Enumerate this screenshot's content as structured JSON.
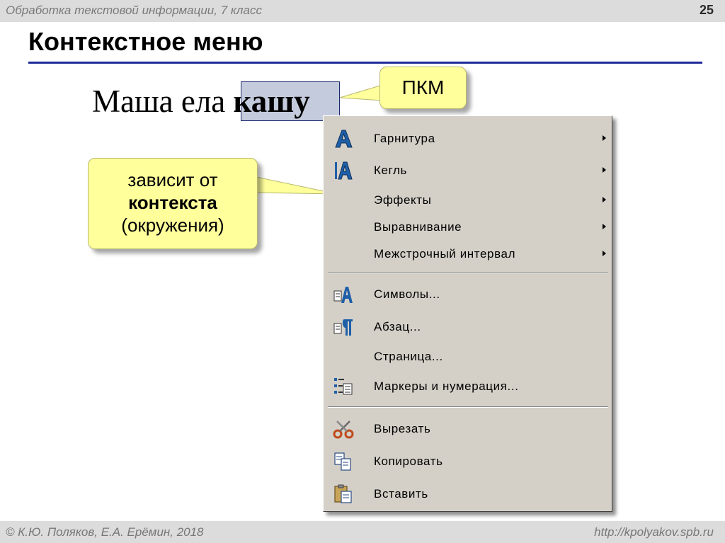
{
  "header": {
    "course_title": "Обработка текстовой информации, 7 класс",
    "slide_number": "25"
  },
  "slide": {
    "title": "Контекстное меню",
    "sentence_plain": "Маша ела ",
    "sentence_selected": "кашу",
    "sentence_end": "."
  },
  "callouts": {
    "pkm": "ПКМ",
    "context_line1": "зависит от",
    "context_line2": "контекста",
    "context_line3": "(окружения)"
  },
  "menu": {
    "items": [
      {
        "label": "Гарнитура",
        "icon": "font-a-icon",
        "submenu": true
      },
      {
        "label": "Кегль",
        "icon": "font-size-icon",
        "submenu": true
      },
      {
        "label": "Эффекты",
        "icon": null,
        "submenu": true
      },
      {
        "label": "Выравнивание",
        "icon": null,
        "submenu": true
      },
      {
        "label": "Межстрочный интервал",
        "icon": null,
        "submenu": true
      },
      {
        "label": "Символы...",
        "icon": "character-format-icon",
        "submenu": false
      },
      {
        "label": "Абзац...",
        "icon": "paragraph-format-icon",
        "submenu": false
      },
      {
        "label": "Страница...",
        "icon": null,
        "submenu": false
      },
      {
        "label": "Маркеры и нумерация...",
        "icon": "bullets-numbering-icon",
        "submenu": false
      },
      {
        "label": "Вырезать",
        "icon": "scissors-icon",
        "submenu": false
      },
      {
        "label": "Копировать",
        "icon": "copy-icon",
        "submenu": false
      },
      {
        "label": "Вставить",
        "icon": "paste-icon",
        "submenu": false
      }
    ]
  },
  "footer": {
    "authors": "© К.Ю. Поляков, Е.А. Ерёмин, 2018",
    "url": "http://kpolyakov.spb.ru"
  },
  "colors": {
    "menu_background": "#d4d0c8",
    "callout_fill": "#ffff9c",
    "title_rule": "#1f2b9a",
    "selection_fill": "#c3cbdc"
  }
}
